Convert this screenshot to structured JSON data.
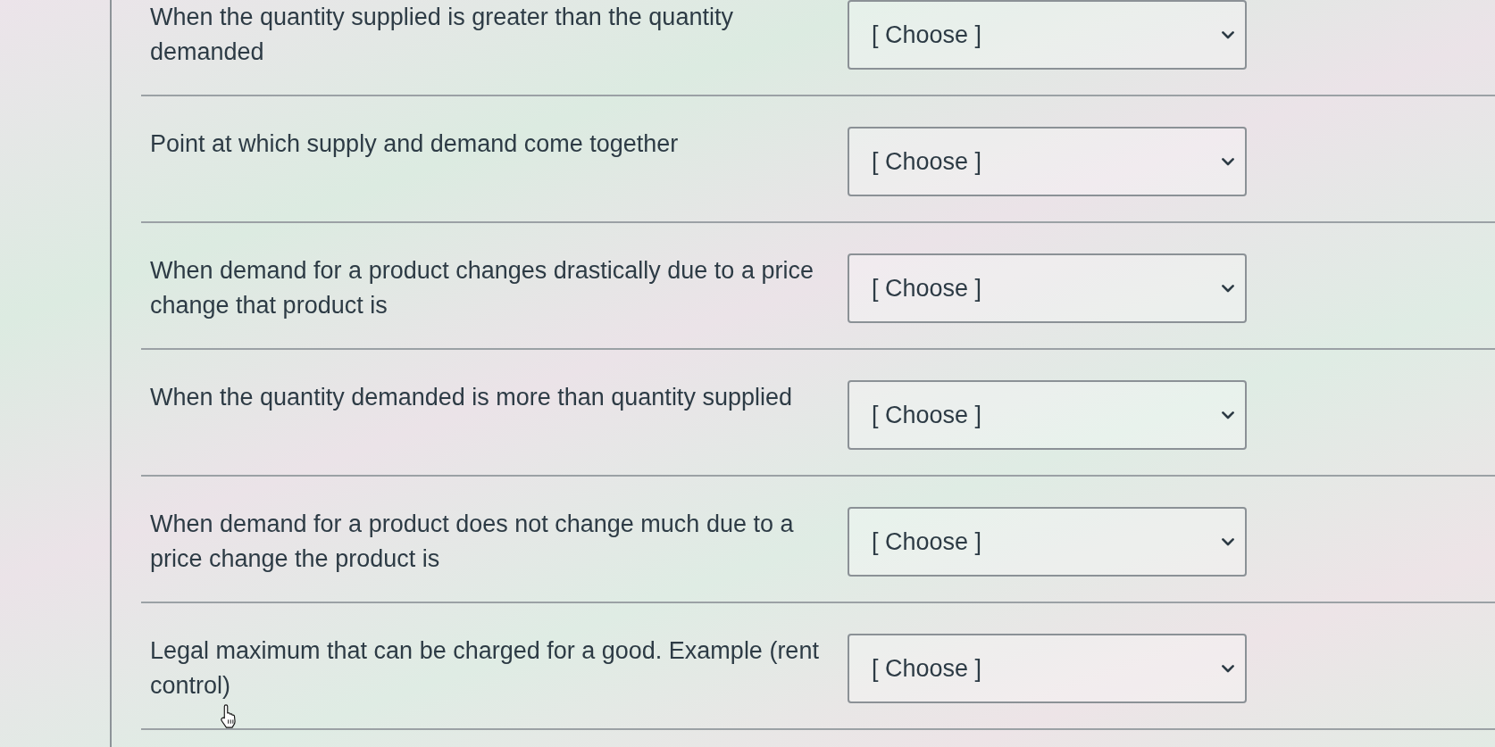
{
  "questions": [
    {
      "prompt": "When the quantity supplied is greater than the quantity demanded",
      "choice": "[ Choose ]"
    },
    {
      "prompt": "Point at which supply and demand come together",
      "choice": "[ Choose ]"
    },
    {
      "prompt": "When demand for a product changes drastically due to a price change that product is",
      "choice": "[ Choose ]"
    },
    {
      "prompt": "When the quantity demanded is more than quantity supplied",
      "choice": "[ Choose ]"
    },
    {
      "prompt": "When demand for a product does not change much due to a price change the product is",
      "choice": "[ Choose ]"
    },
    {
      "prompt": "Legal maximum that can be charged for a good. Example (rent control)",
      "choice": "[ Choose ]"
    }
  ]
}
